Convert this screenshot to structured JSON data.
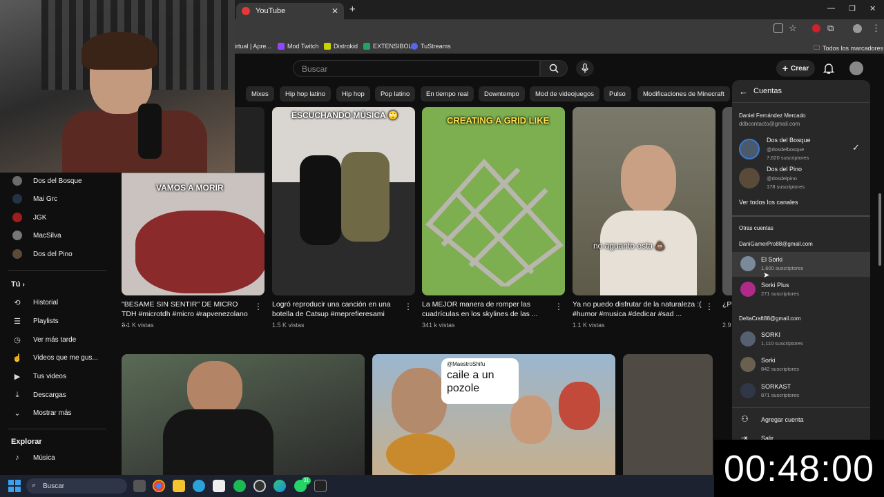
{
  "browser": {
    "tab_title": "YouTube",
    "tab_close": "✕",
    "new_tab": "+",
    "bookmarks": [
      {
        "label": "irtual | Apre...",
        "color": "#999999"
      },
      {
        "label": "Mod Twitch",
        "color": "#9146ff"
      },
      {
        "label": "Distrokid",
        "color": "#c8d400"
      },
      {
        "label": "EXTENSIBOL",
        "color": "#1fa463"
      },
      {
        "label": "TuStreams",
        "color": "#5865f2"
      }
    ],
    "all_bookmarks": "Todos los marcadores"
  },
  "header": {
    "search_placeholder": "Buscar",
    "create_label": "Crear"
  },
  "chips": [
    "Mixes",
    "Hip hop latino",
    "Hip hop",
    "Pop latino",
    "En tiempo real",
    "Downtempo",
    "Mod de videojuegos",
    "Pulso",
    "Modificaciones de Minecraft"
  ],
  "sidebar": {
    "subscriptions": [
      {
        "label": "Dos del Bosque",
        "color": "#6b6b6b"
      },
      {
        "label": "Mai Grc",
        "color": "#223344"
      },
      {
        "label": "JGK",
        "color": "#a01d1d"
      },
      {
        "label": "MacSilva",
        "color": "#777777"
      },
      {
        "label": "Dos del Pino",
        "color": "#5a4a3a"
      }
    ],
    "you_heading": "Tú",
    "you_items": [
      {
        "label": "Historial",
        "icon": "⟲"
      },
      {
        "label": "Playlists",
        "icon": "☰"
      },
      {
        "label": "Ver más tarde",
        "icon": "◷"
      },
      {
        "label": "Videos que me gus...",
        "icon": "👍"
      },
      {
        "label": "Tus videos",
        "icon": "▶"
      },
      {
        "label": "Descargas",
        "icon": "⤓"
      },
      {
        "label": "Mostrar más",
        "icon": "⌄"
      }
    ],
    "explore_heading": "Explorar",
    "explore_items": [
      {
        "label": "Música",
        "icon": "♪"
      }
    ]
  },
  "videos": [
    {
      "title": "\"BESAME SIN SENTIR\" DE MICRO TDH #microtdh #micro #rapvenezolano ...",
      "views": "3.1 K vistas",
      "overlay": "VAMOS A MORIR"
    },
    {
      "title": "Logró reproducir una canción en una botella de Catsup #meprefieresami",
      "views": "1.5 K vistas",
      "overlay": "ESCUCHANDO MÚSICA 🙄"
    },
    {
      "title": "La MEJOR manera de romper las cuadrículas en los skylines de las ...",
      "views": "341 k vistas",
      "overlay": "CREATING A GRID LIKE"
    },
    {
      "title": "Ya no puedo disfrutar de la naturaleza :( #humor #musica #dedicar #sad ...",
      "views": "1.1 K vistas",
      "overlay": "no aguanto esta 💩"
    },
    {
      "title": "¿P al ...",
      "views": "2.9"
    }
  ],
  "row2_overlay": {
    "handle": "@MaestroShifu",
    "text": "caile a un pozole"
  },
  "accounts_panel": {
    "title": "Cuentas",
    "owner_name": "Daniel Fernández Mercado",
    "owner_email": "ddbcontacto@gmail.com",
    "current_accounts": [
      {
        "name": "Dos del Bosque",
        "handle": "@dosdelbosque",
        "subs": "7,620 suscriptores",
        "selected": true,
        "color": "#4a5a6a"
      },
      {
        "name": "Dos del Pino",
        "handle": "@dosdelpino",
        "subs": "178 suscriptores",
        "selected": false,
        "color": "#5a4a3a"
      }
    ],
    "see_all": "Ver todos los canales",
    "other_heading": "Otras cuentas",
    "groups": [
      {
        "email": "DaniGamerPro88@gmail.com",
        "accounts": [
          {
            "name": "El Sorki",
            "subs": "1,600 suscriptores",
            "color": "#7a8a9a"
          },
          {
            "name": "Sorki Plus",
            "subs": "271 suscriptores",
            "color": "#b02a8a"
          }
        ]
      },
      {
        "email": "DeltaCraft88@gmail.com",
        "accounts": [
          {
            "name": "SORKI",
            "subs": "1,110 suscriptores",
            "color": "#556070"
          },
          {
            "name": "Sorki",
            "subs": "842 suscriptores",
            "color": "#6a6050"
          },
          {
            "name": "SORKAST",
            "subs": "871 suscriptores",
            "color": "#303848"
          }
        ]
      }
    ],
    "add_account": "Agregar cuenta",
    "sign_out": "Salir"
  },
  "taskbar": {
    "search_placeholder": "Buscar",
    "whatsapp_badge": "31"
  },
  "timer": "00:48:00"
}
